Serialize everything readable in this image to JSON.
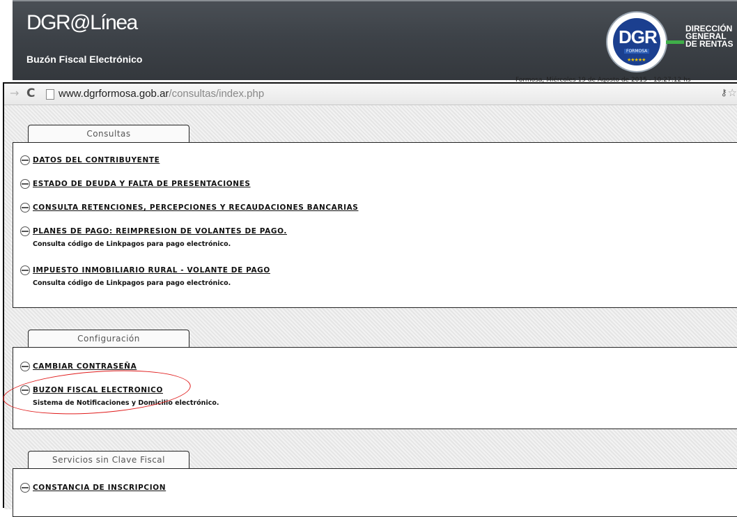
{
  "header": {
    "brand": "DGR@Línea",
    "subtitle": "Buzón Fiscal Electrónico",
    "logo": {
      "acronym": "DGR",
      "region": "FORMOSA",
      "line1": "DIRECCIÓN",
      "line2": "GENERAL",
      "line3": "DE RENTAS"
    },
    "date_strip": "Formosa, Miércoles 19 de Agosto de 2015 - 10:27:12 hs"
  },
  "browser": {
    "url_host": "www.dgrformosa.gob.ar",
    "url_path": "/consultas/index.php"
  },
  "sections": [
    {
      "tab": "Consultas",
      "items": [
        {
          "label": "DATOS DEL CONTRIBUYENTE",
          "desc": ""
        },
        {
          "label": "ESTADO DE DEUDA Y FALTA DE PRESENTACIONES",
          "desc": ""
        },
        {
          "label": "CONSULTA RETENCIONES, PERCEPCIONES Y RECAUDACIONES BANCARIAS",
          "desc": ""
        },
        {
          "label": "PLANES DE PAGO: REIMPRESION DE VOLANTES DE PAGO.",
          "desc": "Consulta código de Linkpagos para pago electrónico."
        },
        {
          "label": "IMPUESTO INMOBILIARIO RURAL - VOLANTE DE PAGO",
          "desc": "Consulta código de Linkpagos para pago electrónico."
        }
      ]
    },
    {
      "tab": "Configuración",
      "items": [
        {
          "label": "CAMBIAR CONTRASEÑA",
          "desc": ""
        },
        {
          "label": "BUZON FISCAL ELECTRONICO",
          "desc": "Sistema de Notificaciones y Domicilio electrónico."
        }
      ]
    },
    {
      "tab": "Servicios sin Clave Fiscal",
      "items": [
        {
          "label": "CONSTANCIA DE INSCRIPCION",
          "desc": ""
        }
      ]
    }
  ],
  "annotation": {
    "highlight_color": "#e01b1b",
    "highlighted_item": "BUZON FISCAL ELECTRONICO"
  }
}
